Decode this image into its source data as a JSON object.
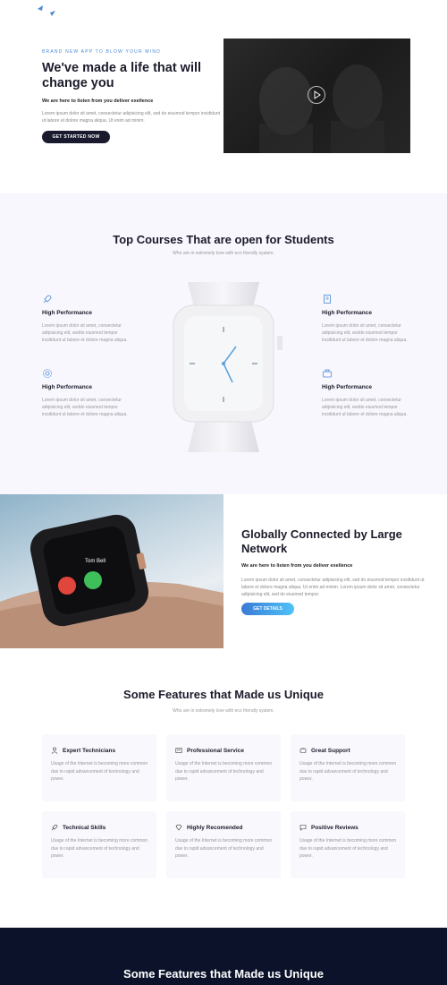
{
  "hero": {
    "eyebrow": "BRAND NEW APP TO BLOW YOUR MIND",
    "title": "We've made a life that will change you",
    "subtitle": "We are here to listen from you deliver exellence",
    "description": "Lorem ipsum dolor sit amet, consectetur adipisicing elit, sed do eiusmod tempor incididunt ut labore et dolore magna aliqua. Ut enim ad minim.",
    "cta_label": "GET STARTED NOW"
  },
  "courses": {
    "title": "Top Courses That are open for Students",
    "subtitle": "Who are in extremely love with eco friendly system.",
    "left": [
      {
        "icon": "rocket-icon",
        "title": "High Performance",
        "desc": "Lorem ipsum dolor sit amet, consectetur adipisicing elit, seddo eiusmod tempor incididunt ut labore et dolore magna aliqua."
      },
      {
        "icon": "gear-icon",
        "title": "High Performance",
        "desc": "Lorem ipsum dolor sit amet, consectetur adipisicing elit, seddo eiusmod tempor incididunt ut labore et dolore magna aliqua."
      }
    ],
    "right": [
      {
        "icon": "book-icon",
        "title": "High Performance",
        "desc": "Lorem ipsum dolor sit amet, consectetur adipisicing elit, seddo eiusmod tempor incididunt ut labore et dolore magna aliqua."
      },
      {
        "icon": "briefcase-icon",
        "title": "High Performance",
        "desc": "Lorem ipsum dolor sit amet, consectetur adipisicing elit, seddo eiusmod tempor incididunt ut labore et dolore magna aliqua."
      }
    ]
  },
  "global": {
    "title": "Globally Connected by Large Network",
    "subtitle": "We are here to listen from you deliver exellence",
    "description": "Lorem ipsum dolor sit amet, consectetur adipisicing elit, sed do eiusmod tempor incididunt ut labore et dolore magna aliqua. Ut enim ad minim. Lorem ipsum dolor sit amet, consectetur adipisicing elit, sed do eiusmod tempor.",
    "cta_label": "GET DETAILS",
    "call_name": "Tom Bell"
  },
  "features": {
    "title": "Some Features that Made us Unique",
    "subtitle": "Who are in extremely love with eco friendly system.",
    "cards": [
      {
        "icon": "user-icon",
        "title": "Expert Technicians",
        "desc": "Usage of the Internet is becoming more common due to rapid advancement of technology and power."
      },
      {
        "icon": "license-icon",
        "title": "Professional Service",
        "desc": "Usage of the Internet is becoming more common due to rapid advancement of technology and power."
      },
      {
        "icon": "phone-icon",
        "title": "Great Support",
        "desc": "Usage of the Internet is becoming more common due to rapid advancement of technology and power."
      },
      {
        "icon": "rocket-icon",
        "title": "Technical Skills",
        "desc": "Usage of the Internet is becoming more common due to rapid advancement of technology and power."
      },
      {
        "icon": "diamond-icon",
        "title": "Highly Recomended",
        "desc": "Usage of the Internet is becoming more common due to rapid advancement of technology and power."
      },
      {
        "icon": "chat-icon",
        "title": "Positive Reviews",
        "desc": "Usage of the Internet is becoming more common due to rapid advancement of technology and power."
      }
    ]
  },
  "dark_band": {
    "title": "Some Features that Made us Unique"
  },
  "colors": {
    "accent_blue": "#4a8ad4",
    "dark_navy": "#0b1229",
    "button_dark": "#1a1a2e"
  }
}
